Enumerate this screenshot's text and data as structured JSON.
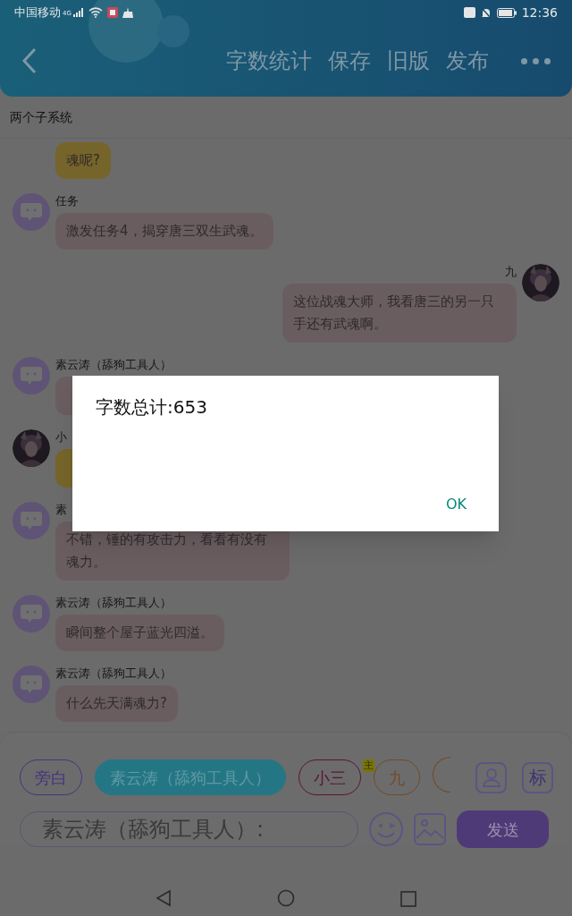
{
  "status_bar": {
    "carrier": "中国移动",
    "network": "4G",
    "time": "12:36"
  },
  "header": {
    "actions": [
      "字数统计",
      "保存",
      "旧版",
      "发布"
    ]
  },
  "title": "两个子系统",
  "messages": [
    {
      "kind": "continued",
      "text": "魂呢?",
      "color": "#76652a"
    },
    {
      "kind": "bot",
      "name": "任务",
      "text": "激发任务4，揭穿唐三双生武魂。",
      "color": "#6a5d60"
    },
    {
      "kind": "self",
      "name": "九",
      "text": "这位战魂大师，我看唐三的另一只手还有武魂啊。",
      "color": "#6a5d60"
    },
    {
      "kind": "bot",
      "name": "素云涛（舔狗工具人）",
      "color": "#6a5d60"
    },
    {
      "name": "小",
      "color": "#76652a"
    },
    {
      "kind": "bot",
      "name": "素",
      "text": "不错，锤的有攻击力，看看有没有魂力。",
      "color": "#6a5d60"
    },
    {
      "kind": "bot",
      "name": "素云涛（舔狗工具人）",
      "text": "瞬间整个屋子蓝光四溢。",
      "color": "#6a5d60"
    },
    {
      "kind": "bot",
      "name": "素云涛（舔狗工具人）",
      "text": "什么先天满魂力?",
      "color": "#6a5d60"
    }
  ],
  "dialog": {
    "message": "字数总计:653",
    "button": "OK"
  },
  "composer": {
    "roles": [
      {
        "label": "旁白",
        "color": "#45347e",
        "selected": false
      },
      {
        "label": "素云涛（舔狗工具人）",
        "color": "#257685",
        "selected": true
      },
      {
        "label": "小三",
        "color": "#5a1434",
        "selected": false,
        "badge": "主"
      },
      {
        "label": "九",
        "color": "#704a2a",
        "selected": false
      },
      {
        "color": "#704a2a",
        "selected": false
      }
    ],
    "tag_button": "标",
    "input_value": "素云涛（舔狗工具人）:",
    "send": "发送"
  }
}
